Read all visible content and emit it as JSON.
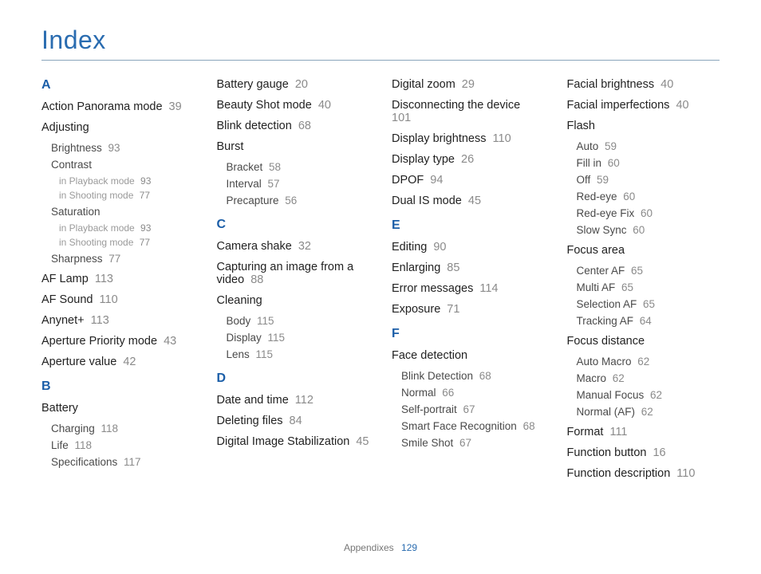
{
  "title": "Index",
  "cols": [
    [
      {
        "type": "letter",
        "text": "A",
        "first": true
      },
      {
        "type": "entry",
        "text": "Action Panorama mode",
        "page": "39"
      },
      {
        "type": "subhead",
        "text": "Adjusting"
      },
      {
        "type": "subentry",
        "text": "Brightness",
        "page": "93"
      },
      {
        "type": "subentry",
        "text": "Contrast"
      },
      {
        "type": "subsubentry",
        "text": "in Playback mode",
        "page": "93"
      },
      {
        "type": "subsubentry",
        "text": "in Shooting mode",
        "page": "77"
      },
      {
        "type": "subentry",
        "text": "Saturation"
      },
      {
        "type": "subsubentry",
        "text": "in Playback mode",
        "page": "93"
      },
      {
        "type": "subsubentry",
        "text": "in Shooting mode",
        "page": "77"
      },
      {
        "type": "subentry",
        "text": "Sharpness",
        "page": "77"
      },
      {
        "type": "entry",
        "text": "AF Lamp",
        "page": "113"
      },
      {
        "type": "entry",
        "text": "AF Sound",
        "page": "110"
      },
      {
        "type": "entry",
        "text": "Anynet+",
        "page": "113"
      },
      {
        "type": "entry",
        "text": "Aperture Priority mode",
        "page": "43"
      },
      {
        "type": "entry",
        "text": "Aperture value",
        "page": "42"
      },
      {
        "type": "letter",
        "text": "B"
      },
      {
        "type": "subhead",
        "text": "Battery"
      },
      {
        "type": "subentry",
        "text": "Charging",
        "page": "118"
      },
      {
        "type": "subentry",
        "text": "Life",
        "page": "118"
      },
      {
        "type": "subentry",
        "text": "Specifications",
        "page": "117"
      }
    ],
    [
      {
        "type": "entry",
        "text": "Battery gauge",
        "page": "20",
        "first": true
      },
      {
        "type": "entry",
        "text": "Beauty Shot mode",
        "page": "40"
      },
      {
        "type": "entry",
        "text": "Blink detection",
        "page": "68"
      },
      {
        "type": "subhead",
        "text": "Burst"
      },
      {
        "type": "subentry",
        "text": "Bracket",
        "page": "58"
      },
      {
        "type": "subentry",
        "text": "Interval",
        "page": "57"
      },
      {
        "type": "subentry",
        "text": "Precapture",
        "page": "56"
      },
      {
        "type": "letter",
        "text": "C"
      },
      {
        "type": "entry",
        "text": "Camera shake",
        "page": "32"
      },
      {
        "type": "entry",
        "text": "Capturing an image from a video",
        "page": "88"
      },
      {
        "type": "subhead",
        "text": "Cleaning"
      },
      {
        "type": "subentry",
        "text": "Body",
        "page": "115"
      },
      {
        "type": "subentry",
        "text": "Display",
        "page": "115"
      },
      {
        "type": "subentry",
        "text": "Lens",
        "page": "115"
      },
      {
        "type": "letter",
        "text": "D"
      },
      {
        "type": "entry",
        "text": "Date and time",
        "page": "112"
      },
      {
        "type": "entry",
        "text": "Deleting files",
        "page": "84"
      },
      {
        "type": "entry",
        "text": "Digital Image Stabilization",
        "page": "45"
      }
    ],
    [
      {
        "type": "entry",
        "text": "Digital zoom",
        "page": "29",
        "first": true
      },
      {
        "type": "entry",
        "text": "Disconnecting the device",
        "page": "101"
      },
      {
        "type": "entry",
        "text": "Display brightness",
        "page": "110"
      },
      {
        "type": "entry",
        "text": "Display type",
        "page": "26"
      },
      {
        "type": "entry",
        "text": "DPOF",
        "page": "94"
      },
      {
        "type": "entry",
        "text": "Dual IS mode",
        "page": "45"
      },
      {
        "type": "letter",
        "text": "E"
      },
      {
        "type": "entry",
        "text": "Editing",
        "page": "90"
      },
      {
        "type": "entry",
        "text": "Enlarging",
        "page": "85"
      },
      {
        "type": "entry",
        "text": "Error messages",
        "page": "114"
      },
      {
        "type": "entry",
        "text": "Exposure",
        "page": "71"
      },
      {
        "type": "letter",
        "text": "F"
      },
      {
        "type": "subhead",
        "text": "Face detection"
      },
      {
        "type": "subentry",
        "text": "Blink Detection",
        "page": "68"
      },
      {
        "type": "subentry",
        "text": "Normal",
        "page": "66"
      },
      {
        "type": "subentry",
        "text": "Self-portrait",
        "page": "67"
      },
      {
        "type": "subentry",
        "text": "Smart Face Recognition",
        "page": "68"
      },
      {
        "type": "subentry",
        "text": "Smile Shot",
        "page": "67"
      }
    ],
    [
      {
        "type": "entry",
        "text": "Facial brightness",
        "page": "40",
        "first": true
      },
      {
        "type": "entry",
        "text": "Facial imperfections",
        "page": "40"
      },
      {
        "type": "subhead",
        "text": "Flash"
      },
      {
        "type": "subentry",
        "text": "Auto",
        "page": "59"
      },
      {
        "type": "subentry",
        "text": "Fill in",
        "page": "60"
      },
      {
        "type": "subentry",
        "text": "Off",
        "page": "59"
      },
      {
        "type": "subentry",
        "text": "Red-eye",
        "page": "60"
      },
      {
        "type": "subentry",
        "text": "Red-eye Fix",
        "page": "60"
      },
      {
        "type": "subentry",
        "text": "Slow Sync",
        "page": "60"
      },
      {
        "type": "subhead",
        "text": "Focus area"
      },
      {
        "type": "subentry",
        "text": "Center AF",
        "page": "65"
      },
      {
        "type": "subentry",
        "text": "Multi AF",
        "page": "65"
      },
      {
        "type": "subentry",
        "text": "Selection AF",
        "page": "65"
      },
      {
        "type": "subentry",
        "text": "Tracking AF",
        "page": "64"
      },
      {
        "type": "subhead",
        "text": "Focus distance"
      },
      {
        "type": "subentry",
        "text": "Auto Macro",
        "page": "62"
      },
      {
        "type": "subentry",
        "text": "Macro",
        "page": "62"
      },
      {
        "type": "subentry",
        "text": "Manual Focus",
        "page": "62"
      },
      {
        "type": "subentry",
        "text": "Normal (AF)",
        "page": "62"
      },
      {
        "type": "entry",
        "text": "Format",
        "page": "111"
      },
      {
        "type": "entry",
        "text": "Function button",
        "page": "16"
      },
      {
        "type": "entry",
        "text": "Function description",
        "page": "110"
      }
    ]
  ],
  "footer": {
    "label": "Appendixes",
    "page": "129"
  }
}
